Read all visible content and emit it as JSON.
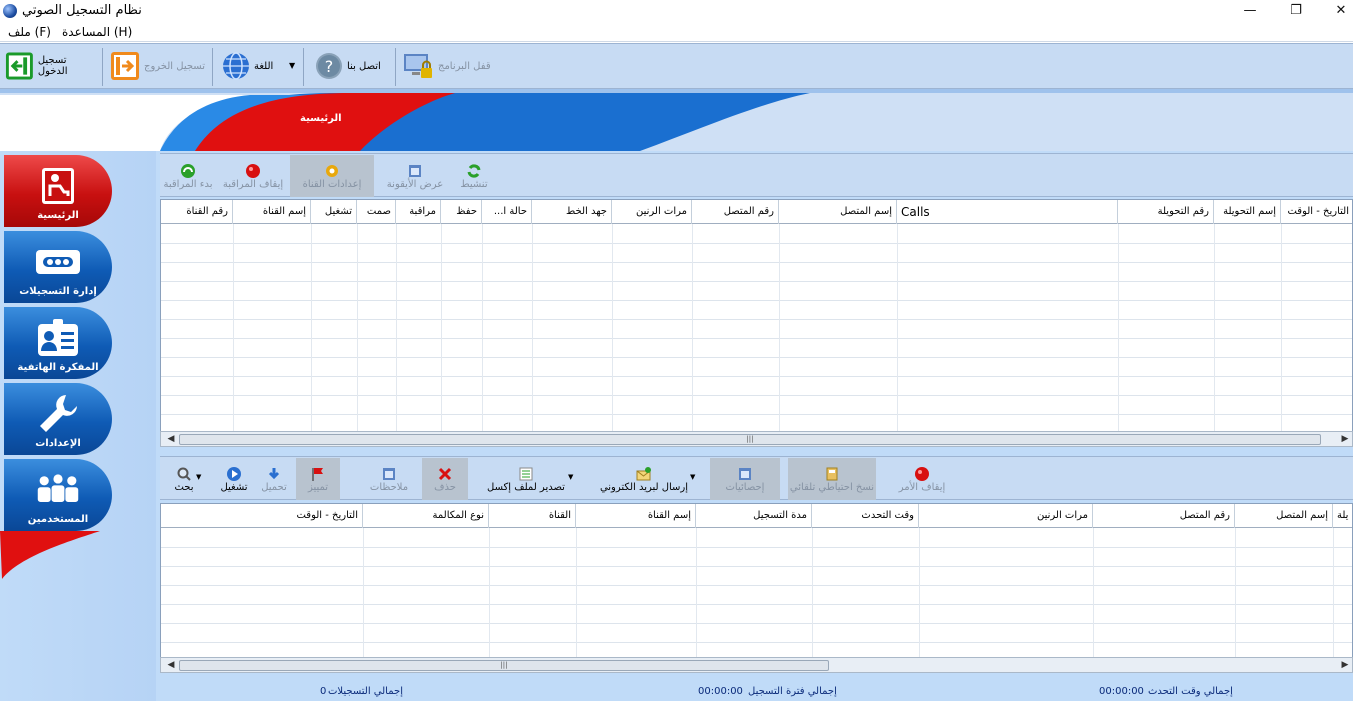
{
  "window": {
    "title": "نظام التسجيل الصوتي",
    "minimize": "—",
    "maximize": "❐",
    "close": "✕"
  },
  "menu": [
    "ملف (F)",
    "المساعدة (H)"
  ],
  "toolbar": {
    "login": "تسجيل الدخول",
    "logout": "تسجيل الخروج",
    "language": "اللغة",
    "contact": "اتصل بنا",
    "lock": "قفل البرنامج"
  },
  "banner": {
    "tab_home": "الرئيسية"
  },
  "nav": [
    {
      "label": "الرئيسية",
      "icon": "person-desk-icon"
    },
    {
      "label": "إدارة التسجيلات",
      "icon": "cassette-icon"
    },
    {
      "label": "المفكرة الهاتفية",
      "icon": "phonebook-icon"
    },
    {
      "label": "الإعدادات",
      "icon": "wrench-icon"
    },
    {
      "label": "المستخدمين",
      "icon": "users-icon"
    }
  ],
  "top_toolbar": {
    "start_monitor": "بدء المراقبة",
    "stop_monitor": "إيقاف المراقبة",
    "channel_settings": "إعدادات القناة",
    "show_icons": "عرض الأيقونة",
    "activate": "تنشيط"
  },
  "top_columns": [
    "التاريخ - الوقت",
    "إسم التحويلة",
    "رقم التحويلة",
    "Calls",
    "إسم المتصل",
    "رقم المتصل",
    "مرات الرنين",
    "جهد الخط",
    "...حالة ا",
    "حفظ",
    "مراقبة",
    "صمت",
    "تشغيل",
    "إسم القناة",
    "رقم القناة"
  ],
  "bottom_toolbar": {
    "stop_cmd": "إيقاف الأمر",
    "auto_backup": "نسخ احتياطي تلقائي",
    "statistics": "إحصائيات",
    "send_email": "إرسال لبريد الكتروني",
    "export_excel": "تصدير لملف إكسل",
    "delete": "حذف",
    "notes": "ملاحظات",
    "highlight": "تمييز",
    "download": "تحميل",
    "play": "تشغيل",
    "search": "بحث"
  },
  "bottom_columns": [
    "يلة",
    "إسم المتصل",
    "رقم المتصل",
    "مرات الرنين",
    "وقت التحدث",
    "مدة التسجيل",
    "إسم القناة",
    "القناة",
    "نوع المكالمة",
    "التاريخ - الوقت"
  ],
  "status": {
    "total_talk": "إجمالي وقت التحدث",
    "total_talk_val": "00:00:00",
    "total_rec": "إجمالي فترة التسجيل",
    "total_rec_val": "00:00:00",
    "total_count": "إجمالي التسجيلات",
    "total_count_val": "0"
  },
  "scroll_grip": "|||"
}
